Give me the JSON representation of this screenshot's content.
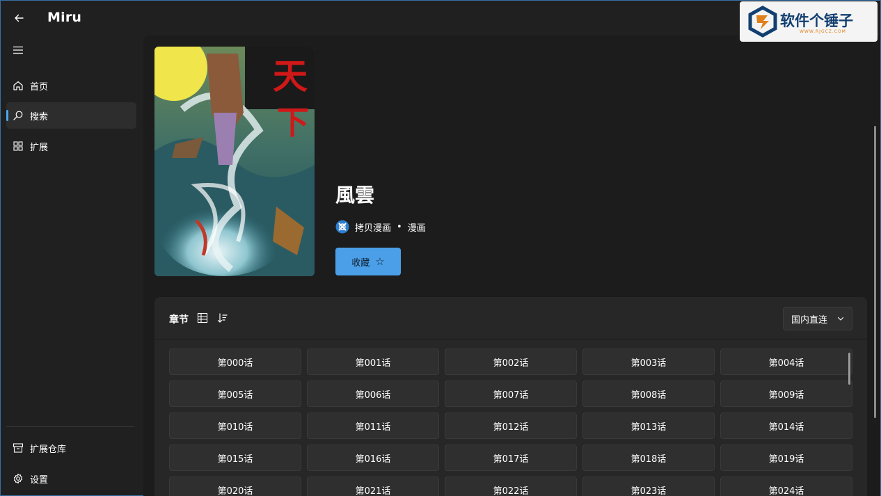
{
  "app": {
    "title": "Miru"
  },
  "sidebar": {
    "items": [
      {
        "label": "首页",
        "icon": "home-icon"
      },
      {
        "label": "搜索",
        "icon": "search-icon",
        "active": true
      },
      {
        "label": "扩展",
        "icon": "extensions-icon"
      }
    ],
    "footer_items": [
      {
        "label": "扩展仓库",
        "icon": "repository-icon"
      },
      {
        "label": "设置",
        "icon": "gear-icon"
      }
    ]
  },
  "detail": {
    "title": "風雲",
    "source": "拷贝漫画",
    "separator": "•",
    "type": "漫画",
    "favorite_label": "收藏",
    "favorite_icon": "☆"
  },
  "chapters": {
    "title": "章节",
    "route": "国内直连",
    "items": [
      "第000话",
      "第001话",
      "第002话",
      "第003话",
      "第004话",
      "第005话",
      "第006话",
      "第007话",
      "第008话",
      "第009话",
      "第010话",
      "第011话",
      "第012话",
      "第013话",
      "第014话",
      "第015话",
      "第016话",
      "第017话",
      "第018话",
      "第019话",
      "第020话",
      "第021话",
      "第022话",
      "第023话",
      "第024话"
    ]
  },
  "watermark": {
    "name": "软件个锤子",
    "url": "WWW.RJGCZ.COM"
  },
  "colors": {
    "accent": "#4a9fe8",
    "background": "#202020",
    "panel": "#272727",
    "button": "#2f2f2f"
  }
}
